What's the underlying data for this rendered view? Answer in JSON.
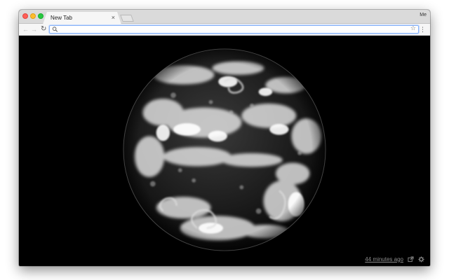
{
  "browser": {
    "tab": {
      "title": "New Tab",
      "close_glyph": "×"
    },
    "profile_label": "Me",
    "toolbar": {
      "back_icon": "back-arrow-icon",
      "forward_icon": "forward-arrow-icon",
      "reload_icon": "reload-icon",
      "omnibox_value": "",
      "bookmark_icon": "star-icon",
      "menu_icon": "vertical-dots-icon"
    }
  },
  "page": {
    "image_subject": "earth-satellite-image",
    "timestamp": "44 minutes ago",
    "external_link_icon": "external-link-icon",
    "settings_icon": "gear-icon"
  },
  "colors": {
    "background": "#000000",
    "omnibox_focus": "#8ab4f8",
    "footer_text": "#8d8d8d"
  }
}
